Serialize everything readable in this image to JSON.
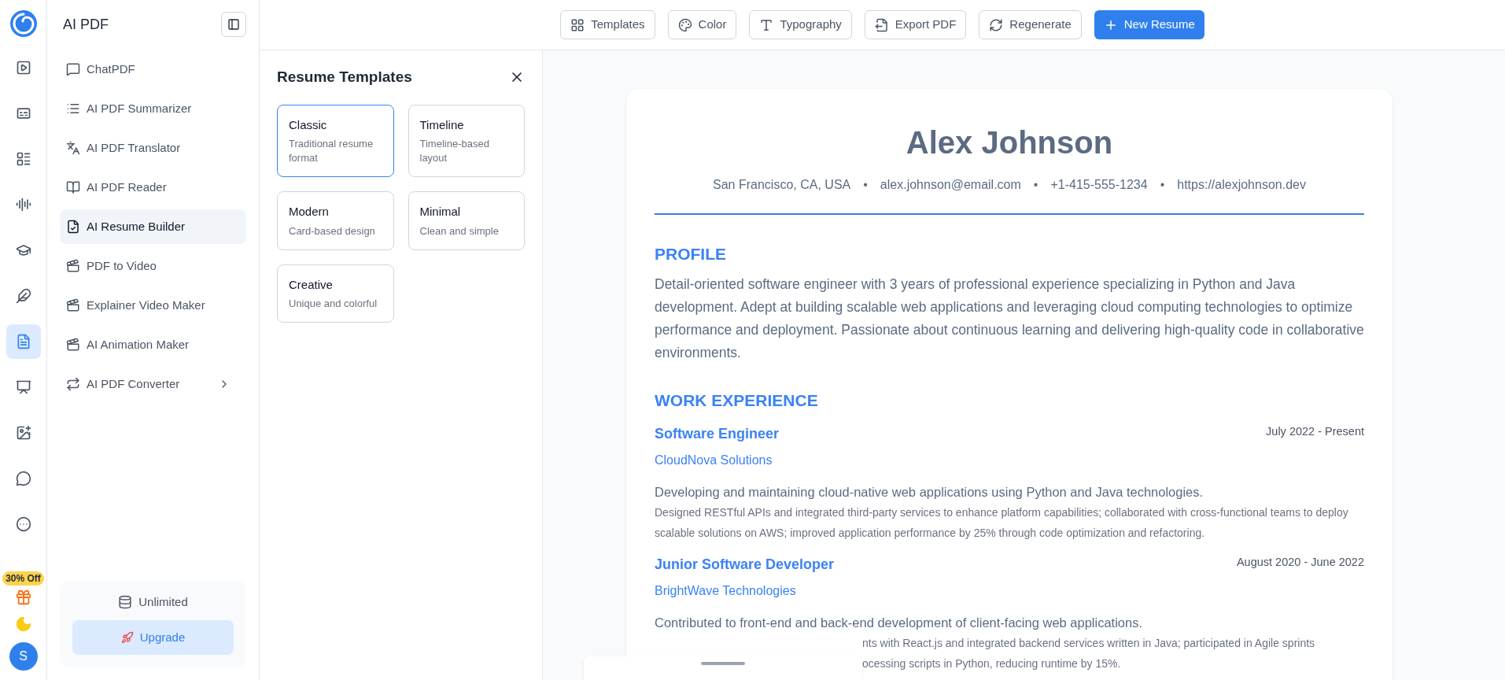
{
  "rail": {
    "items": [
      {
        "kind": "play",
        "selected": false
      },
      {
        "kind": "captions",
        "selected": false
      },
      {
        "kind": "list",
        "selected": false
      },
      {
        "kind": "audio",
        "selected": false
      },
      {
        "kind": "graduation",
        "selected": false
      },
      {
        "kind": "pen",
        "selected": false
      },
      {
        "kind": "pdf",
        "selected": true
      },
      {
        "kind": "presentation",
        "selected": false
      },
      {
        "kind": "image",
        "selected": false
      },
      {
        "kind": "chat",
        "selected": false
      },
      {
        "kind": "more",
        "selected": false
      }
    ],
    "promo": "30% Off",
    "avatar": "S"
  },
  "sidebar": {
    "title": "AI PDF",
    "items": [
      {
        "label": "ChatPDF",
        "kind": "chat",
        "selected": false,
        "has_submenu": false
      },
      {
        "label": "AI PDF Summarizer",
        "kind": "list",
        "selected": false,
        "has_submenu": false
      },
      {
        "label": "AI PDF Translator",
        "kind": "translate",
        "selected": false,
        "has_submenu": false
      },
      {
        "label": "AI PDF Reader",
        "kind": "book",
        "selected": false,
        "has_submenu": false
      },
      {
        "label": "AI Resume Builder",
        "kind": "resume",
        "selected": true,
        "has_submenu": false
      },
      {
        "label": "PDF to Video",
        "kind": "video",
        "selected": false,
        "has_submenu": false
      },
      {
        "label": "Explainer Video Maker",
        "kind": "video",
        "selected": false,
        "has_submenu": false
      },
      {
        "label": "AI Animation Maker",
        "kind": "video",
        "selected": false,
        "has_submenu": false
      },
      {
        "label": "AI PDF Converter",
        "kind": "convert",
        "selected": false,
        "has_submenu": true
      }
    ],
    "plan": "Unlimited",
    "upgrade": "Upgrade"
  },
  "toolbar": {
    "buttons": [
      {
        "label": "Templates",
        "kind": "grid",
        "primary": false
      },
      {
        "label": "Color",
        "kind": "color",
        "primary": false
      },
      {
        "label": "Typography",
        "kind": "type",
        "primary": false
      },
      {
        "label": "Export PDF",
        "kind": "export",
        "primary": false
      },
      {
        "label": "Regenerate",
        "kind": "refresh",
        "primary": false
      },
      {
        "label": "New Resume",
        "kind": "plus",
        "primary": true
      }
    ]
  },
  "templates_panel": {
    "title": "Resume Templates",
    "templates": [
      {
        "name": "Classic",
        "description": "Traditional resume format",
        "selected": true
      },
      {
        "name": "Timeline",
        "description": "Timeline-based layout",
        "selected": false
      },
      {
        "name": "Modern",
        "description": "Card-based design",
        "selected": false
      },
      {
        "name": "Minimal",
        "description": "Clean and simple",
        "selected": false
      },
      {
        "name": "Creative",
        "description": "Unique and colorful",
        "selected": false
      }
    ]
  },
  "resume": {
    "name": "Alex Johnson",
    "separator": "•",
    "contacts": [
      "San Francisco, CA, USA",
      "alex.johnson@email.com",
      "+1-415-555-1234",
      "https://alexjohnson.dev"
    ],
    "profile": {
      "heading": "PROFILE",
      "text": "Detail-oriented software engineer with 3 years of professional experience specializing in Python and Java development. Adept at building scalable web applications and leveraging cloud computing technologies to optimize performance and deployment. Passionate about continuous learning and delivering high-quality code in collaborative environments."
    },
    "experience": {
      "heading": "WORK EXPERIENCE",
      "jobs": [
        {
          "title": "Software Engineer",
          "company": "CloudNova Solutions",
          "dates": "July 2022 - Present",
          "summary": "Developing and maintaining cloud-native web applications using Python and Java technologies.",
          "details": [
            "Designed RESTful APIs and integrated third-party services to enhance platform capabilities; collaborated with cross-functional teams to deploy scalable solutions on AWS; improved application performance by 25% through code optimization and refactoring."
          ],
          "partly_covered": false
        },
        {
          "title": "Junior Software Developer",
          "company": "BrightWave Technologies",
          "dates": "August 2020 - June 2022",
          "summary": "Contributed to front-end and back-end development of client-facing web applications.",
          "details": [
            "nts with React.js and integrated backend services written in Java; participated in Agile sprints",
            "ocessing scripts in Python, reducing runtime by 15%."
          ],
          "partly_covered": true
        }
      ]
    }
  }
}
